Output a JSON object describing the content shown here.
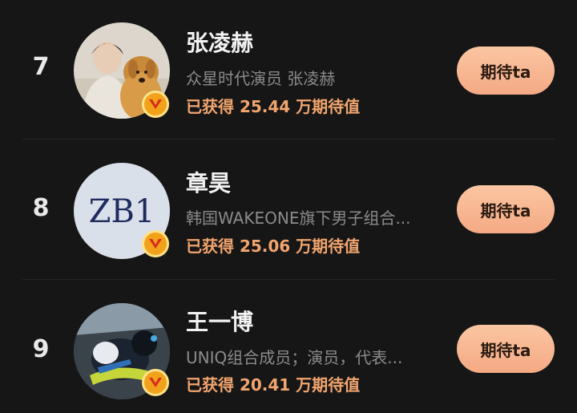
{
  "items": [
    {
      "rank": "7",
      "name": "张凌赫",
      "description": "众星时代演员 张凌赫",
      "score_text": "已获得 25.44 万期待值",
      "button_label": "期待ta",
      "verified_icon": "v-verified-icon"
    },
    {
      "rank": "8",
      "name": "章昊",
      "description": "韩国WAKEONE旗下男子组合...",
      "score_text": "已获得 25.06 万期待值",
      "button_label": "期待ta",
      "verified_icon": "v-verified-icon",
      "avatar_logo_text": "ZB1"
    },
    {
      "rank": "9",
      "name": "王一博",
      "description": "UNIQ组合成员；演员，代表...",
      "score_text": "已获得 20.41 万期待值",
      "button_label": "期待ta",
      "verified_icon": "v-verified-icon"
    }
  ],
  "colors": {
    "background": "#161616",
    "name": "#f2f2f2",
    "description": "#8b8b8b",
    "score": "#f2a56e",
    "button": "#f7b692",
    "badge": "#f2a21a"
  }
}
